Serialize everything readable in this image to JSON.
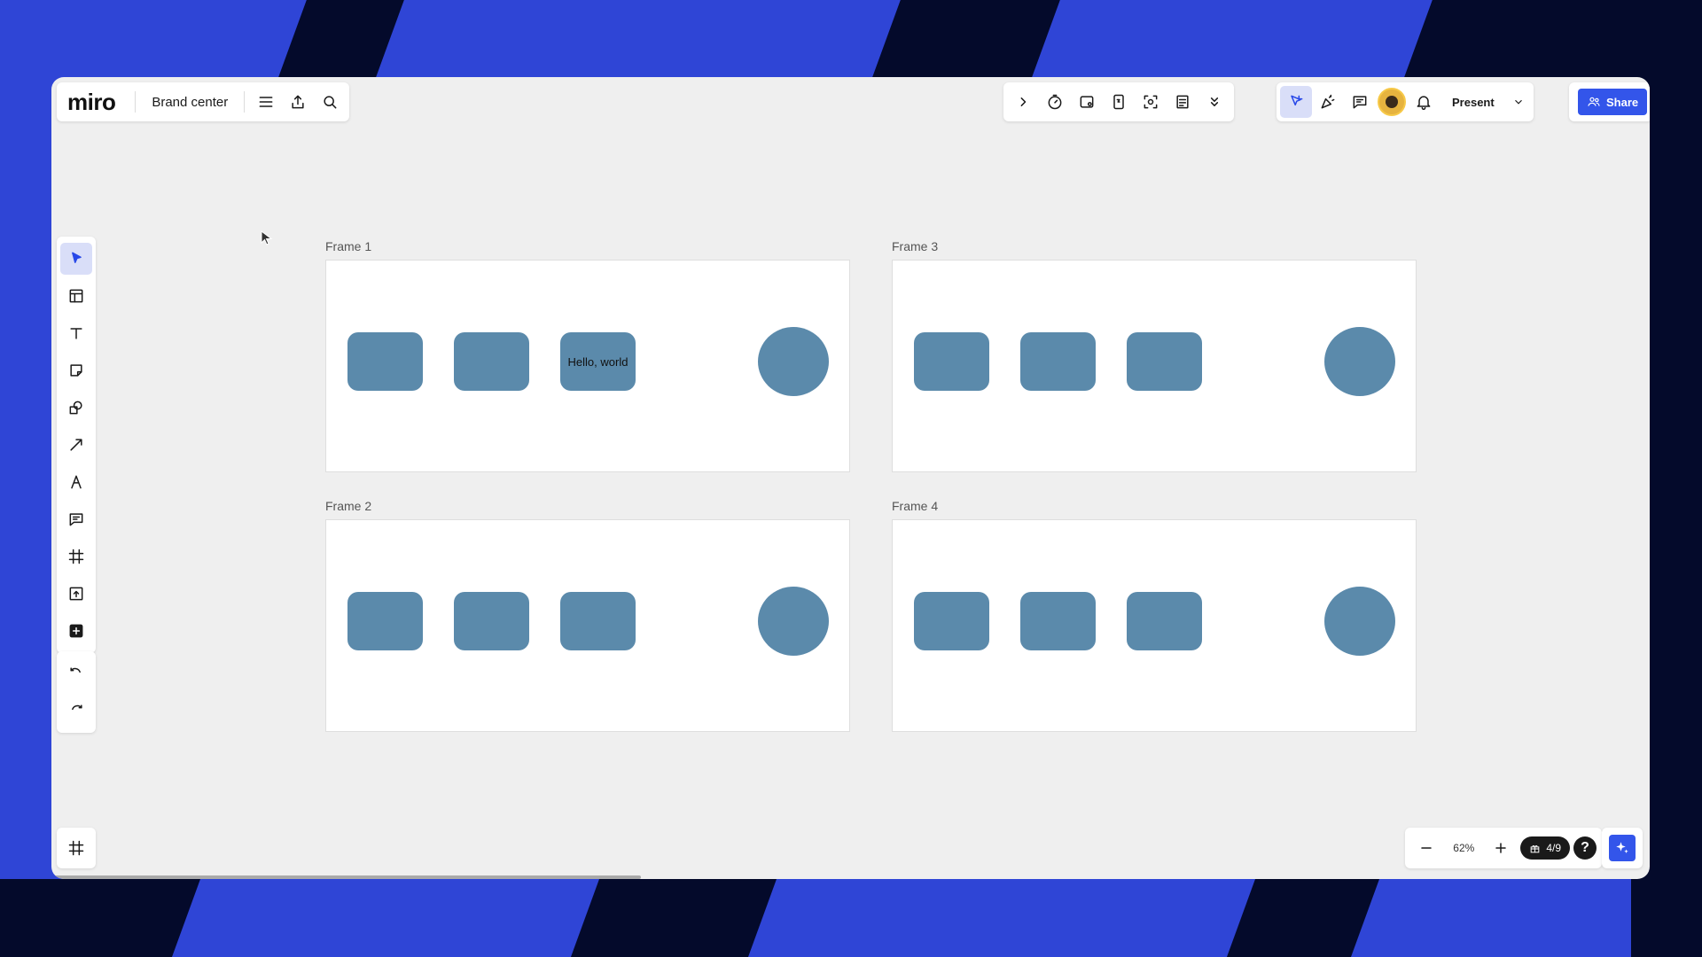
{
  "header": {
    "logo": "miro",
    "board_name": "Brand center"
  },
  "toolbar_right": {
    "present_label": "Present",
    "share_label": "Share"
  },
  "frames": [
    {
      "label": "Frame 1",
      "shapes": [
        "",
        "",
        "Hello, world"
      ]
    },
    {
      "label": "Frame 3",
      "shapes": [
        "",
        "",
        ""
      ]
    },
    {
      "label": "Frame 2",
      "shapes": [
        "",
        "",
        ""
      ]
    },
    {
      "label": "Frame 4",
      "shapes": [
        "",
        "",
        ""
      ]
    }
  ],
  "zoom": {
    "level": "62%",
    "frame_counter": "4/9"
  },
  "help_label": "?",
  "colors": {
    "accent": "#3355ea",
    "shape_fill": "#5b8aab",
    "canvas": "#efefef"
  },
  "icons": {
    "left_toolbar": [
      "select-icon",
      "templates-icon",
      "text-icon",
      "sticky-note-icon",
      "shapes-icon",
      "connector-icon",
      "pen-icon",
      "comment-icon",
      "frame-icon",
      "upload-icon",
      "more-apps-icon",
      "undo-icon",
      "redo-icon"
    ],
    "top_right": [
      "expand-icon",
      "timer-icon",
      "video-icon",
      "voting-icon",
      "focus-icon",
      "notes-icon",
      "more-icon",
      "cursor-follow-icon",
      "celebrate-icon",
      "chat-icon",
      "notifications-icon"
    ]
  }
}
